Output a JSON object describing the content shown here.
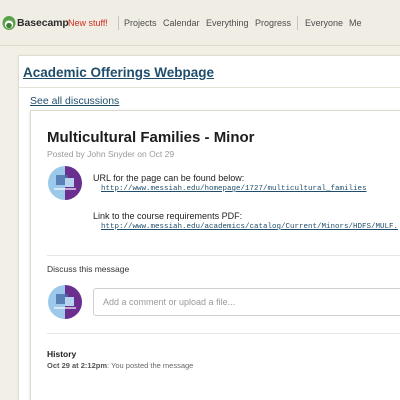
{
  "app": {
    "name": "Basecamp",
    "new_stuff": "New stuff!"
  },
  "nav": {
    "items": [
      "Projects",
      "Calendar",
      "Everything",
      "Progress",
      "Everyone",
      "Me"
    ]
  },
  "project": {
    "title": "Academic Offerings Webpage",
    "see_all": "See all discussions"
  },
  "message": {
    "title": "Multicultural Families - Minor",
    "meta": "Posted by John Snyder on Oct 29",
    "paragraph1": "URL for the page can be found below:",
    "link1": "http://www.messiah.edu/homepage/1727/multicultural_families",
    "paragraph2": "Link to the course requirements PDF:",
    "link2": "http://www.messiah.edu/academics/catalog/Current/Minors/HDFS/MULF."
  },
  "discussion": {
    "label": "Discuss this message",
    "placeholder": "Add a comment or upload a file..."
  },
  "history": {
    "label": "History",
    "date": "Oct 29 at 2:12pm",
    "text": ": You posted the message"
  },
  "colors": {
    "link": "#1f4d6b",
    "new_stuff": "#d22d1e",
    "avatar_light": "#9cc9ea",
    "avatar_dark": "#6a2f8f",
    "background": "#f2efe6"
  },
  "icons": {
    "logo": "basecamp-logo-icon",
    "avatar": "user-avatar-icon"
  }
}
